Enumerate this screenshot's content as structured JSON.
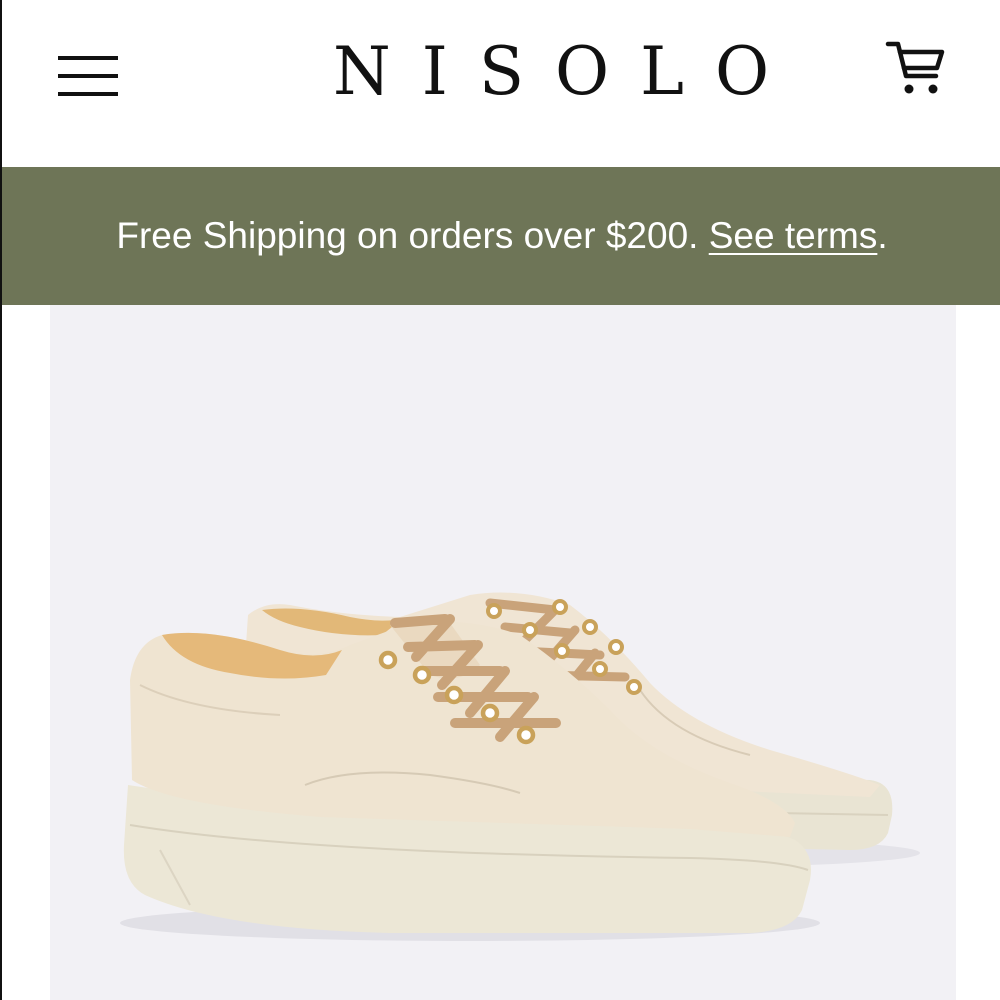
{
  "header": {
    "menu_icon": "hamburger-menu-icon",
    "logo_text": "NISOLO",
    "cart_icon": "shopping-cart-icon"
  },
  "promo_banner": {
    "text": "Free Shipping on orders over $200. ",
    "link_text": "See terms",
    "trailing_text": ".",
    "background_color": "#6e7557",
    "text_color": "#ffffff"
  },
  "product": {
    "image": "cream-leather-lace-up-sneakers-pair",
    "image_background_color": "#f2f1f5",
    "shoe_color": "#efe4d1",
    "sole_color": "#ece7d6",
    "lace_color": "#c9a37a",
    "eyelet_color": "#c9a25a"
  }
}
